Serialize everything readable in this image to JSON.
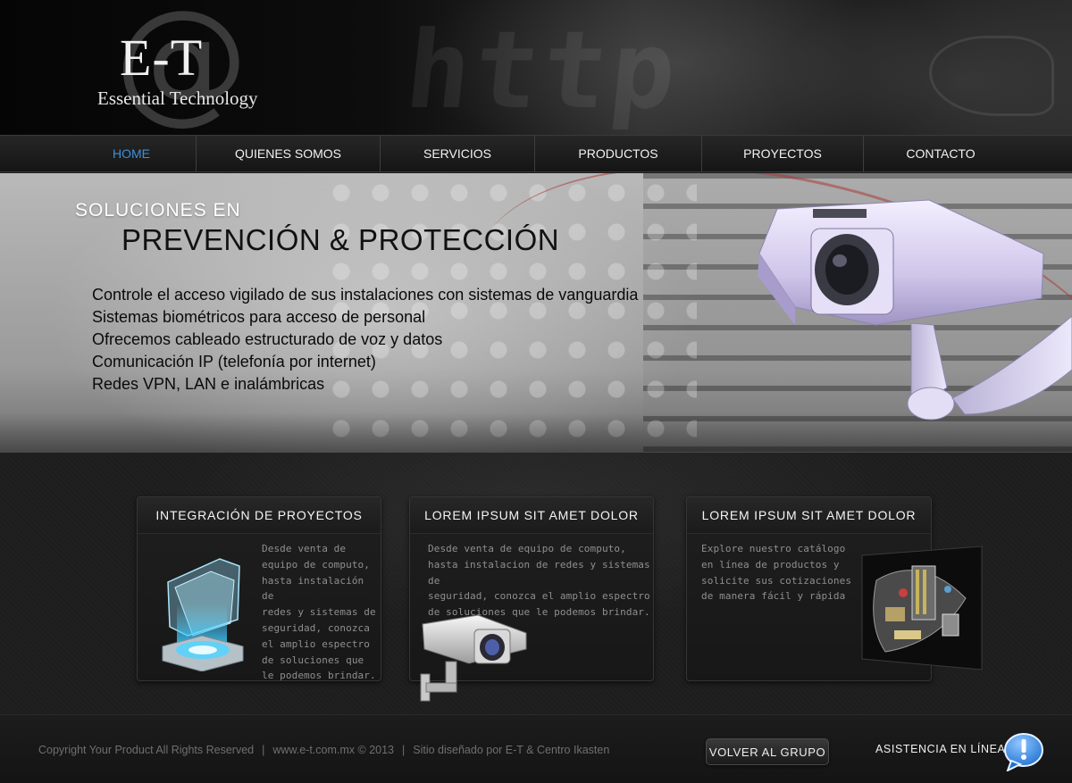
{
  "brand": {
    "logo_mark": "E-T",
    "name": "Essential Technology"
  },
  "nav": {
    "items": [
      {
        "label": "HOME",
        "active": true
      },
      {
        "label": "QUIENES SOMOS",
        "active": false
      },
      {
        "label": "SERVICIOS",
        "active": false
      },
      {
        "label": "PRODUCTOS",
        "active": false
      },
      {
        "label": "PROYECTOS",
        "active": false
      },
      {
        "label": "CONTACTO",
        "active": false
      }
    ],
    "active_color": "#3f8fd8"
  },
  "hero": {
    "pretitle": "SOLUCIONES EN",
    "title": "PREVENCIÓN & PROTECCIÓN",
    "bullets": [
      "Controle el acceso vigilado de sus instalaciones con sistemas de vanguardia",
      "Sistemas biométricos para acceso de personal",
      "Ofrecemos cableado estructurado de voz y datos",
      "Comunicación IP (telefonía por internet)",
      "Redes VPN, LAN e inalámbricas"
    ],
    "image_icon": "security-camera-icon"
  },
  "cards": [
    {
      "title": "INTEGRACIÓN DE PROYECTOS",
      "text_lines": [
        "Desde venta de",
        "equipo de computo,",
        "hasta instalación de",
        "redes y sistemas de",
        "seguridad, conozca",
        "el amplio espectro",
        "de soluciones que",
        "le podemos brindar."
      ],
      "icon": "folder-hologram-icon"
    },
    {
      "title": "LOREM IPSUM SIT AMET DOLOR",
      "text_lines": [
        "Desde venta de equipo de computo,",
        "hasta instalacion de redes y sistemas de",
        "seguridad, conozca el amplio espectro",
        "de soluciones que le podemos brindar."
      ],
      "icon": "security-camera-icon"
    },
    {
      "title": "LOREM IPSUM SIT AMET DOLOR",
      "text_lines": [
        "Explore nuestro catálogo",
        "en línea de productos y",
        "solicite sus cotizaciones",
        "de manera fácil y rápida"
      ],
      "icon": "circuit-board-icon"
    }
  ],
  "footer": {
    "copyright": "Copyright Your Product All Rights Reserved",
    "site": "www.e-t.com.mx © 2013",
    "credit": "Sitio diseñado por E-T & Centro Ikasten",
    "separator": "|",
    "volver_label": "VOLVER AL GRUPO",
    "asistencia_label": "ASISTENCIA EN LÍNEA",
    "chat_icon": "chat-bubble-exclamation-icon"
  }
}
